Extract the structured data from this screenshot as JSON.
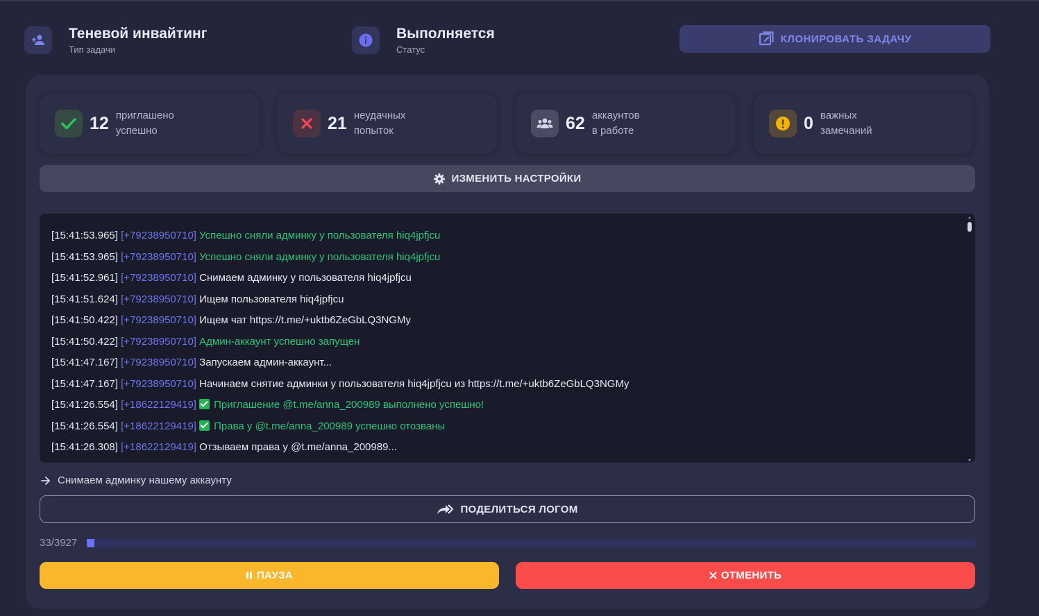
{
  "header": {
    "task_type": {
      "title": "Теневой инвайтинг",
      "subtitle": "Тип задачи",
      "icon": "person-add-icon"
    },
    "status": {
      "title": "Выполняется",
      "subtitle": "Статус",
      "icon": "info-icon"
    },
    "clone_label": "КЛОНИРОВАТЬ ЗАДАЧУ"
  },
  "stats": [
    {
      "value": "12",
      "line1": "приглашено",
      "line2": "успешно",
      "icon": "check-icon",
      "color": "#2fbf5f"
    },
    {
      "value": "21",
      "line1": "неудачных",
      "line2": "попыток",
      "icon": "cross-icon",
      "color": "#f0474f"
    },
    {
      "value": "62",
      "line1": "аккаунтов",
      "line2": "в работе",
      "icon": "users-icon",
      "color": "#c9cbe0"
    },
    {
      "value": "0",
      "line1": "важных",
      "line2": "замечаний",
      "icon": "warning-icon",
      "color": "#f5b20a"
    }
  ],
  "settings_label": "ИЗМЕНИТЬ НАСТРОЙКИ",
  "log": [
    {
      "time": "[15:41:53.965]",
      "phone": "[+79238950710]",
      "text": "Успешно сняли админку у пользователя hiq4jpfjcu",
      "kind": "ok",
      "check": false
    },
    {
      "time": "[15:41:53.965]",
      "phone": "[+79238950710]",
      "text": "Успешно сняли админку у пользователя hiq4jpfjcu",
      "kind": "ok",
      "check": false
    },
    {
      "time": "[15:41:52.961]",
      "phone": "[+79238950710]",
      "text": "Снимаем админку у пользователя hiq4jpfjcu",
      "kind": "plain",
      "check": false
    },
    {
      "time": "[15:41:51.624]",
      "phone": "[+79238950710]",
      "text": "Ищем пользователя hiq4jpfjcu",
      "kind": "plain",
      "check": false
    },
    {
      "time": "[15:41:50.422]",
      "phone": "[+79238950710]",
      "text": "Ищем чат https://t.me/+uktb6ZeGbLQ3NGMy",
      "kind": "plain",
      "check": false
    },
    {
      "time": "[15:41:50.422]",
      "phone": "[+79238950710]",
      "text": "Админ-аккаунт успешно запущен",
      "kind": "ok",
      "check": false
    },
    {
      "time": "[15:41:47.167]",
      "phone": "[+79238950710]",
      "text": "Запускаем админ-аккаунт...",
      "kind": "plain",
      "check": false
    },
    {
      "time": "[15:41:47.167]",
      "phone": "[+79238950710]",
      "text": "Начинаем снятие админки у пользователя hiq4jpfjcu из https://t.me/+uktb6ZeGbLQ3NGMy",
      "kind": "plain",
      "check": false
    },
    {
      "time": "[15:41:26.554]",
      "phone": "[+18622129419]",
      "text": "Приглашение @t.me/anna_200989 выполнено успешно!",
      "kind": "ok",
      "check": true
    },
    {
      "time": "[15:41:26.554]",
      "phone": "[+18622129419]",
      "text": "Права у @t.me/anna_200989 успешно отозваны",
      "kind": "ok",
      "check": true
    },
    {
      "time": "[15:41:26.308]",
      "phone": "[+18622129419]",
      "text": "Отзываем права у @t.me/anna_200989...",
      "kind": "plain",
      "check": false
    }
  ],
  "current_step": "Снимаем админку нашему аккаунту",
  "share_label": "ПОДЕЛИТЬСЯ ЛОГОМ",
  "progress": {
    "label": "33/3927",
    "done": 33,
    "total": 3927
  },
  "pause_label": "ПАУЗА",
  "cancel_label": "ОТМЕНИТЬ"
}
